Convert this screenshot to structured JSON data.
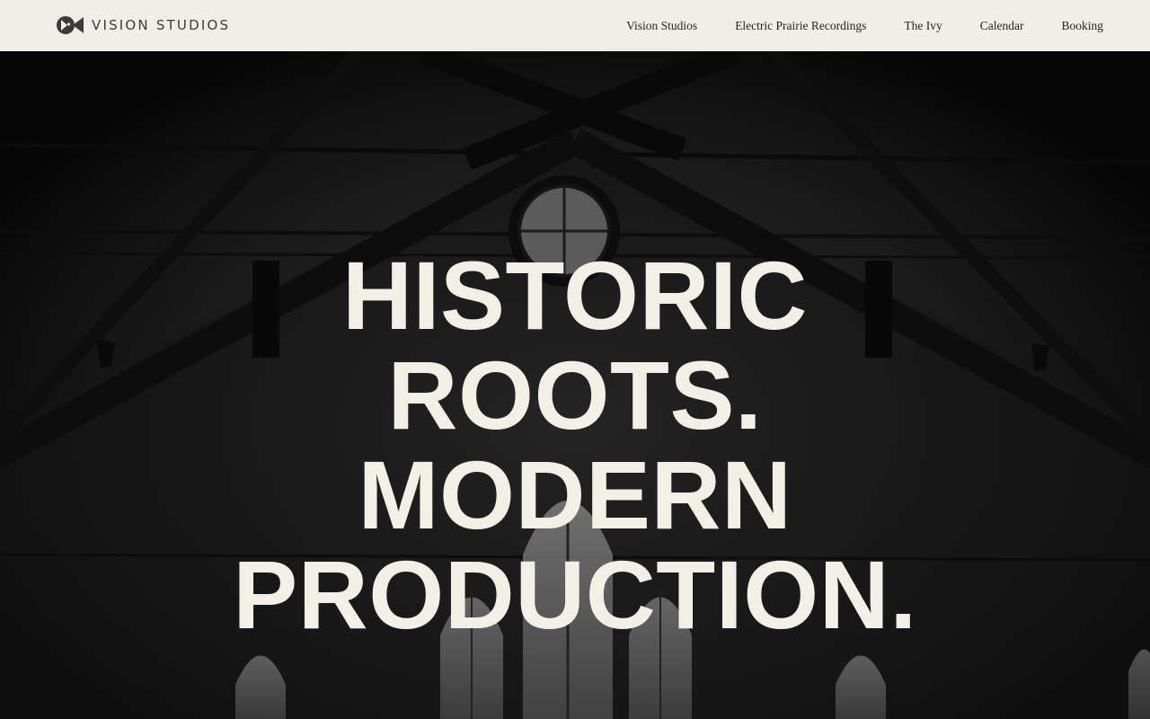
{
  "header": {
    "brand_name": "VISION STUDIOS",
    "brand_logo_icon": "fish-logo-icon",
    "nav": [
      {
        "label": "Vision Studios"
      },
      {
        "label": "Electric Prairie Recordings"
      },
      {
        "label": "The Ivy"
      },
      {
        "label": "Calendar"
      },
      {
        "label": "Booking"
      }
    ]
  },
  "hero": {
    "headline_lines": [
      "HISTORIC",
      "ROOTS.",
      "MODERN",
      "PRODUCTION."
    ],
    "background": "Black-and-white church interior with exposed roof trusses and arched windows"
  },
  "colors": {
    "header_bg": "#f1eee7",
    "header_text": "#232323",
    "brand_text": "#3b3b3b",
    "headline_text": "#f2efe6",
    "hero_dark": "#1a1a1a"
  }
}
